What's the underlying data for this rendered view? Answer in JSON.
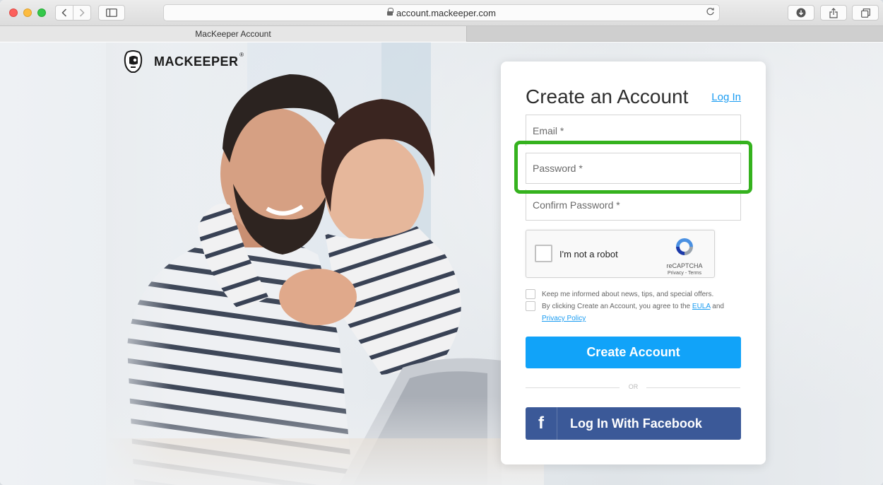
{
  "browser": {
    "url": "account.mackeeper.com",
    "tab_title": "MacKeeper Account"
  },
  "logo": {
    "text": "MACKEEPER",
    "registered": "®"
  },
  "form": {
    "title": "Create an Account",
    "login_link": "Log In",
    "email_placeholder": "Email *",
    "password_placeholder": "Password *",
    "confirm_placeholder": "Confirm Password *",
    "recaptcha": {
      "label": "I'm not a robot",
      "brand": "reCAPTCHA",
      "links": "Privacy - Terms"
    },
    "newsletter_text": "Keep me informed about news, tips, and special offers.",
    "agree_prefix": "By clicking Create an Account, you agree to the",
    "eula_link": "EULA",
    "and_text": "and",
    "privacy_link": "Privacy Policy",
    "create_button": "Create Account",
    "or_text": "OR",
    "facebook_button": "Log In With Facebook",
    "facebook_icon": "f"
  },
  "colors": {
    "primary": "#11a3f9",
    "facebook": "#3b5998",
    "highlight": "#35b21e",
    "link": "#1a9cf2"
  }
}
